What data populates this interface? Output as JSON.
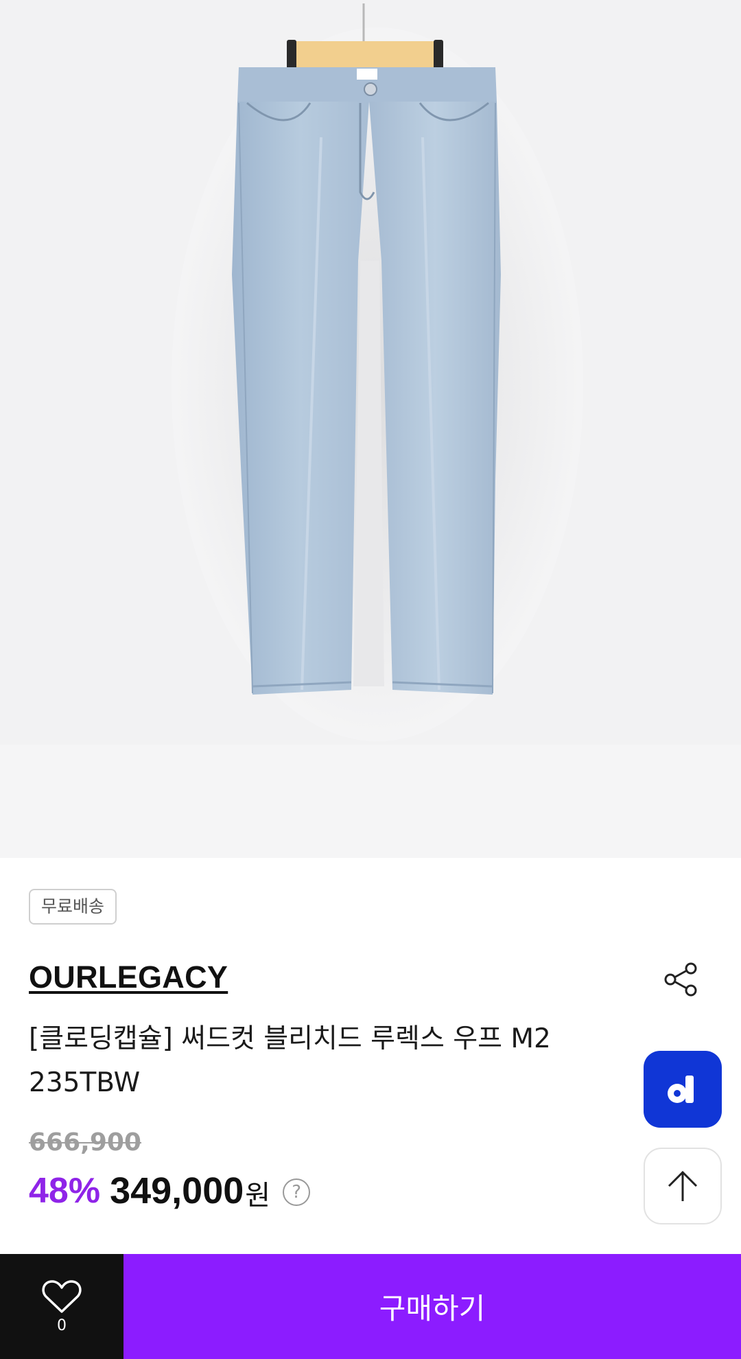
{
  "product": {
    "image_alt": "light wash straight jeans on hanger",
    "shipping_badge": "무료배송",
    "brand": "OURLEGACY",
    "title": "[클로딩캡슐] 써드컷 블리치드 루렉스 우프 M2 235TBW",
    "original_price": "666,900",
    "discount": "48%",
    "price": "349,000",
    "currency": "원",
    "help_symbol": "?"
  },
  "floating": {
    "d_button_label": "d",
    "top_button_icon": "arrow-up-icon"
  },
  "bottom_bar": {
    "like_count": "0",
    "buy_label": "구매하기"
  },
  "icons": {
    "share": "share-icon",
    "heart": "heart-icon",
    "help": "question-circle-icon"
  },
  "colors": {
    "accent_purple": "#8c1cff",
    "discount_purple": "#8f24e8",
    "d_button_blue": "#1036d6",
    "like_box_black": "#111111"
  }
}
